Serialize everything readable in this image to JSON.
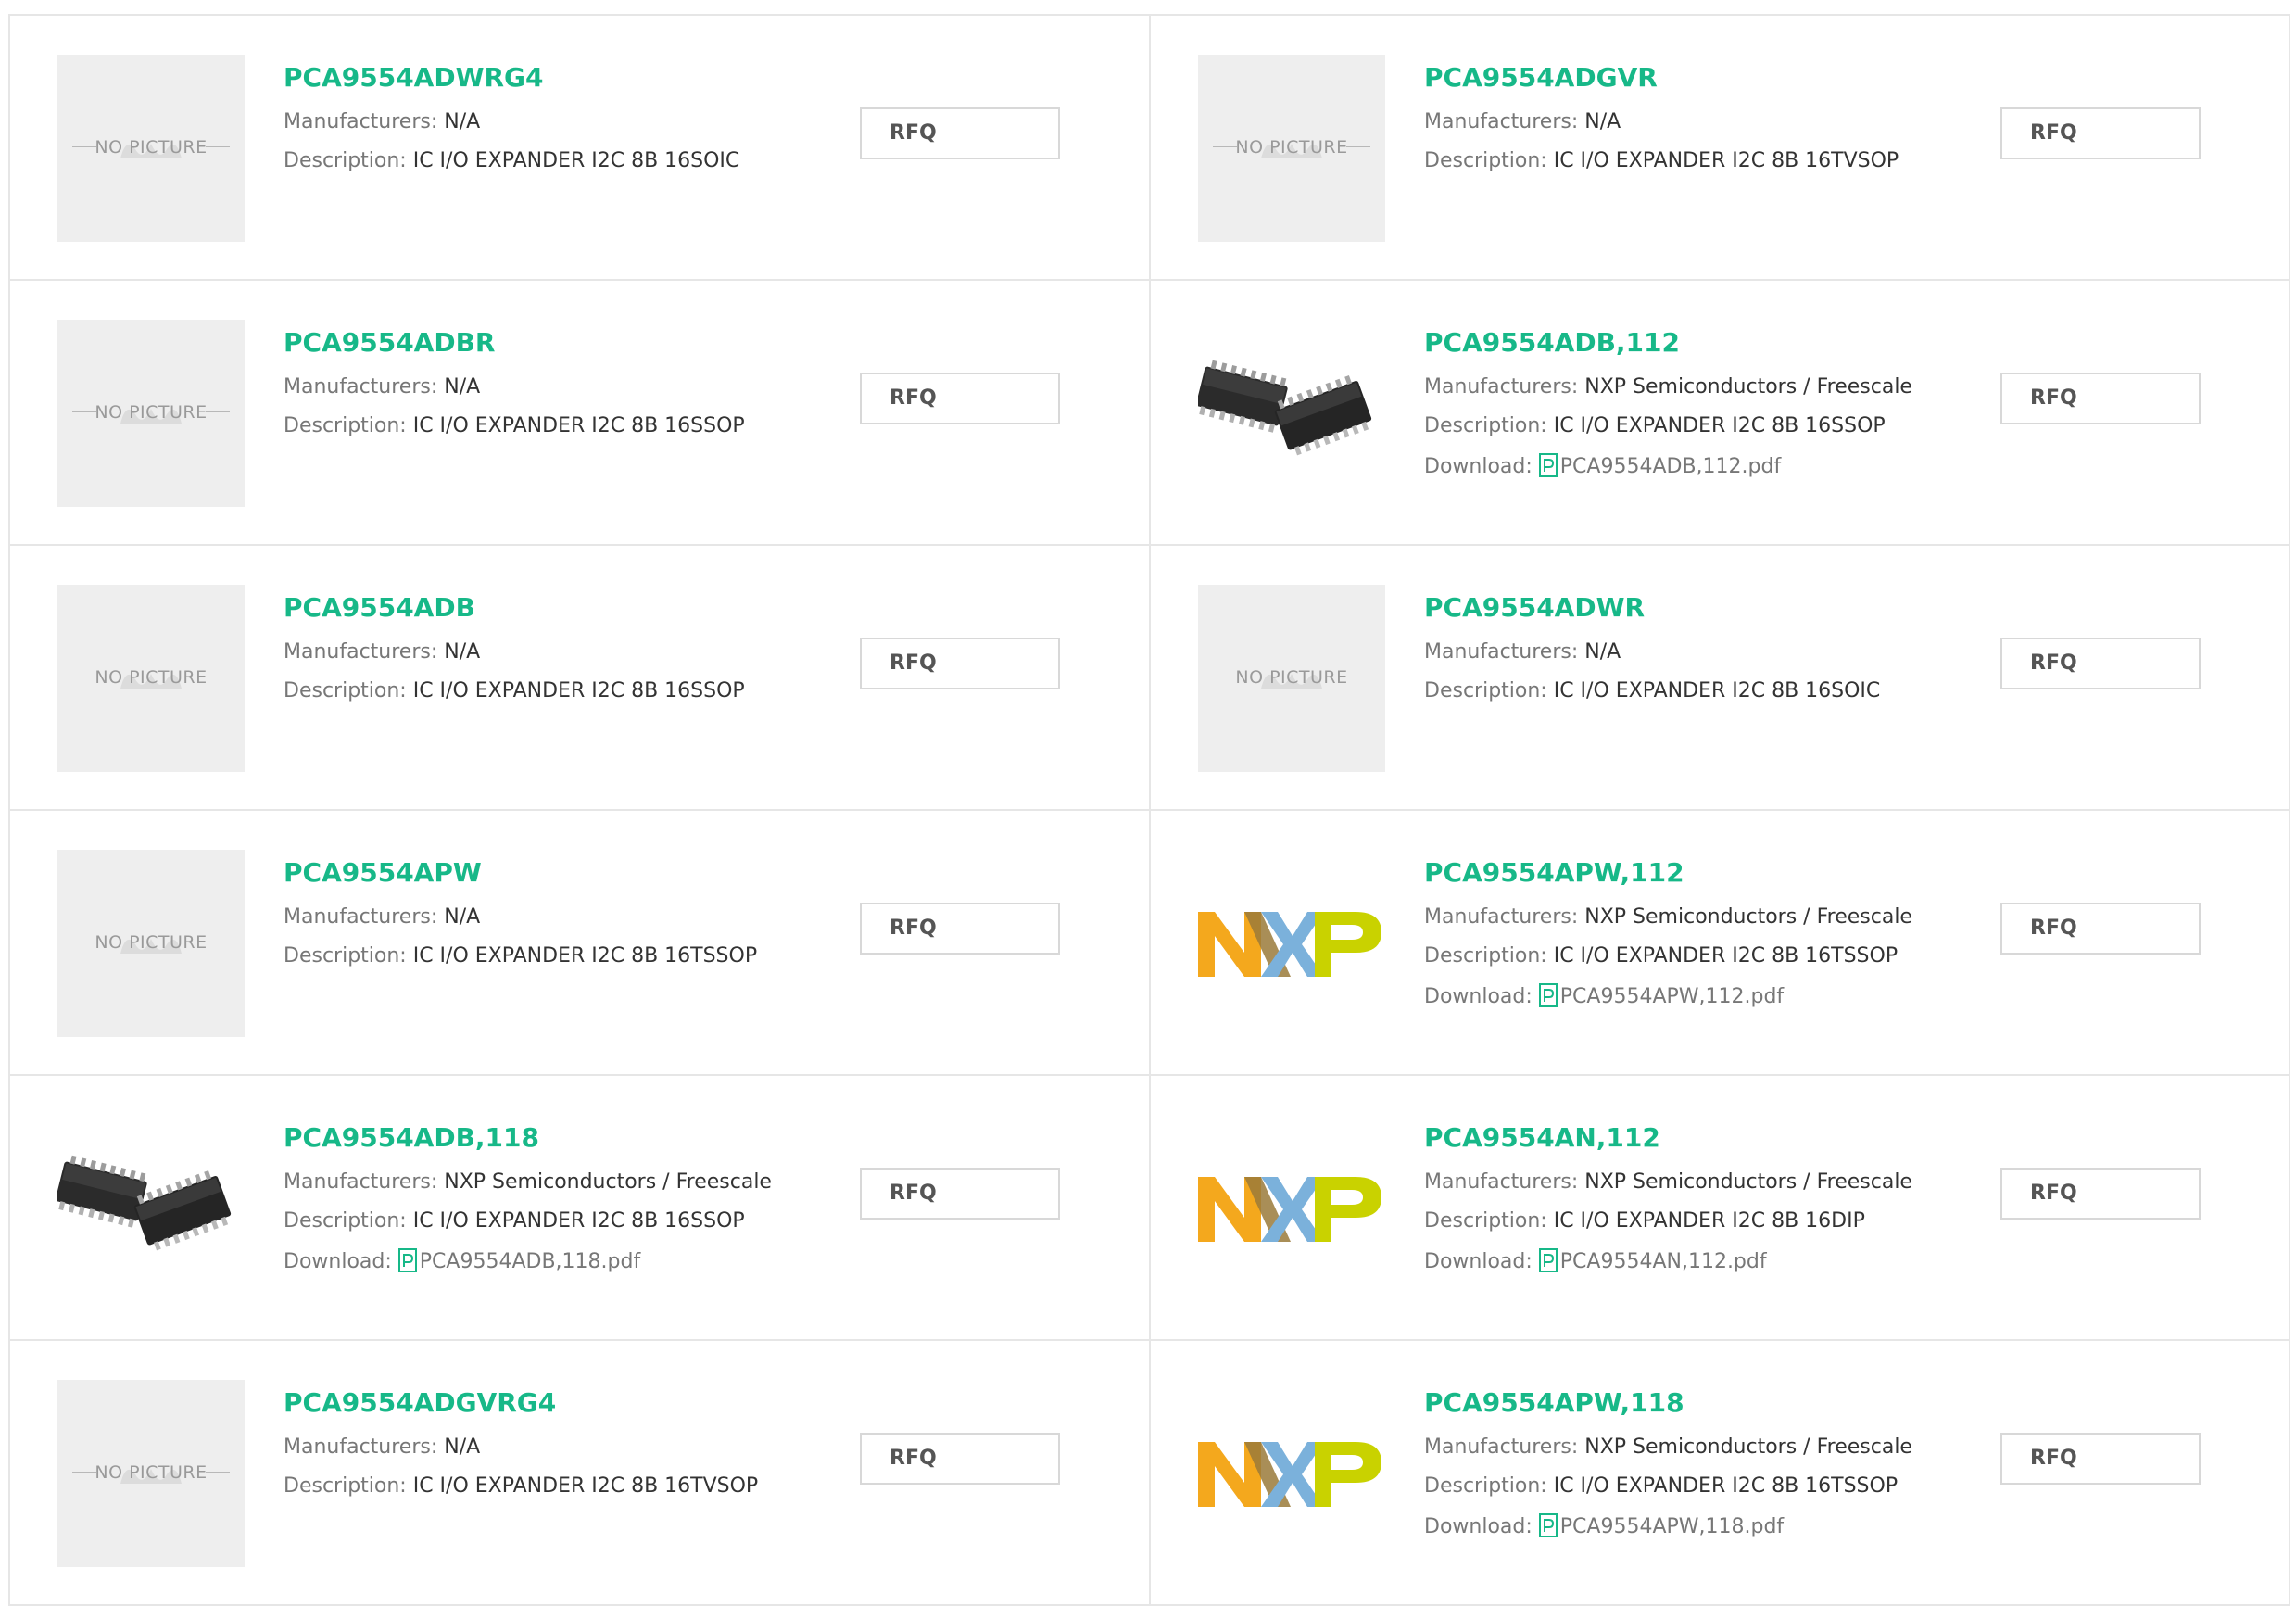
{
  "labels": {
    "manufacturers": "Manufacturers:",
    "description": "Description:",
    "download": "Download:",
    "rfq": "RFQ",
    "no_picture": "NO PICTURE"
  },
  "products": [
    {
      "part": "PCA9554ADWRG4",
      "manufacturer": "N/A",
      "description": "IC I/O EXPANDER I2C 8B 16SOIC",
      "image": "no-picture"
    },
    {
      "part": "PCA9554ADGVR",
      "manufacturer": "N/A",
      "description": "IC I/O EXPANDER I2C 8B 16TVSOP",
      "image": "no-picture"
    },
    {
      "part": "PCA9554ADBR",
      "manufacturer": "N/A",
      "description": "IC I/O EXPANDER I2C 8B 16SSOP",
      "image": "no-picture"
    },
    {
      "part": "PCA9554ADB,112",
      "manufacturer": "NXP Semiconductors / Freescale",
      "description": "IC I/O EXPANDER I2C 8B 16SSOP",
      "download": "PCA9554ADB,112.pdf",
      "image": "chip-photo"
    },
    {
      "part": "PCA9554ADB",
      "manufacturer": "N/A",
      "description": "IC I/O EXPANDER I2C 8B 16SSOP",
      "image": "no-picture"
    },
    {
      "part": "PCA9554ADWR",
      "manufacturer": "N/A",
      "description": "IC I/O EXPANDER I2C 8B 16SOIC",
      "image": "no-picture"
    },
    {
      "part": "PCA9554APW",
      "manufacturer": "N/A",
      "description": "IC I/O EXPANDER I2C 8B 16TSSOP",
      "image": "no-picture"
    },
    {
      "part": "PCA9554APW,112",
      "manufacturer": "NXP Semiconductors / Freescale",
      "description": "IC I/O EXPANDER I2C 8B 16TSSOP",
      "download": "PCA9554APW,112.pdf",
      "image": "nxp-logo"
    },
    {
      "part": "PCA9554ADB,118",
      "manufacturer": "NXP Semiconductors / Freescale",
      "description": "IC I/O EXPANDER I2C 8B 16SSOP",
      "download": "PCA9554ADB,118.pdf",
      "image": "chip-photo"
    },
    {
      "part": "PCA9554AN,112",
      "manufacturer": "NXP Semiconductors / Freescale",
      "description": "IC I/O EXPANDER I2C 8B 16DIP",
      "download": "PCA9554AN,112.pdf",
      "image": "nxp-logo"
    },
    {
      "part": "PCA9554ADGVRG4",
      "manufacturer": "N/A",
      "description": "IC I/O EXPANDER I2C 8B 16TVSOP",
      "image": "no-picture"
    },
    {
      "part": "PCA9554APW,118",
      "manufacturer": "NXP Semiconductors / Freescale",
      "description": "IC I/O EXPANDER I2C 8B 16TSSOP",
      "download": "PCA9554APW,118.pdf",
      "image": "nxp-logo"
    }
  ],
  "colors": {
    "accent": "#17b888",
    "nxp_orange": "#f4a81d",
    "nxp_blue": "#7bb1db",
    "nxp_green": "#c9d200"
  }
}
